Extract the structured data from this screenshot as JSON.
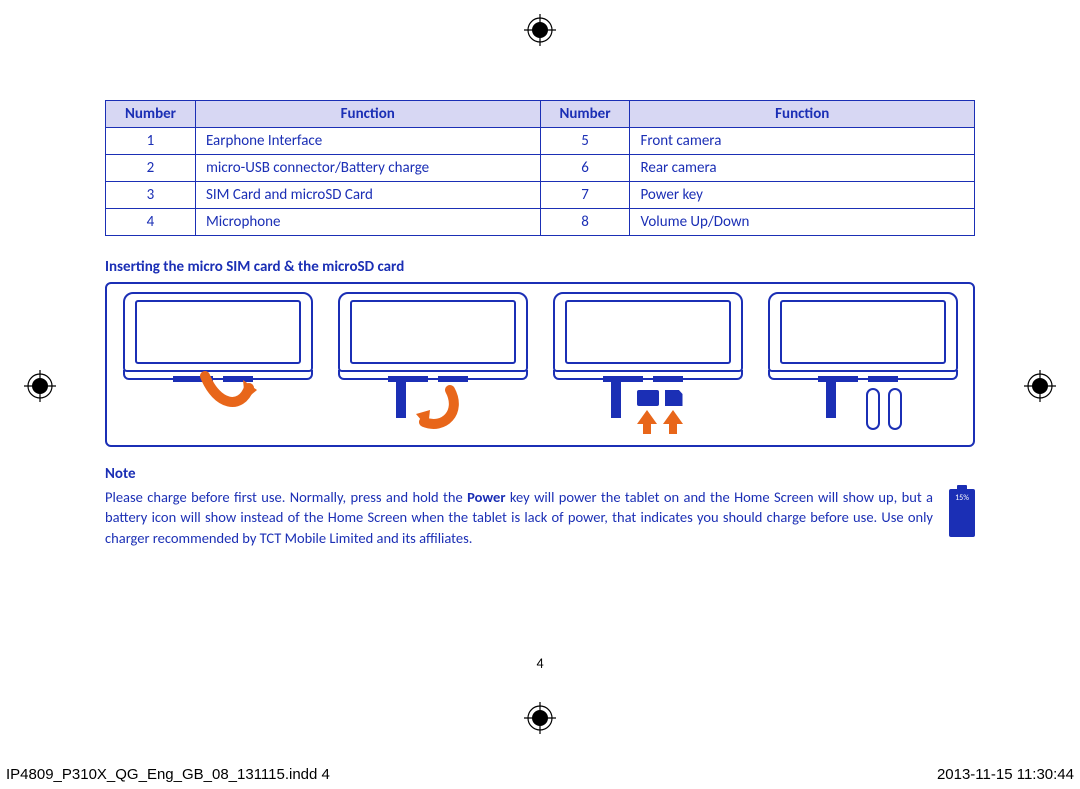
{
  "table": {
    "headers": {
      "number": "Number",
      "function": "Function"
    },
    "rows": [
      {
        "n1": "1",
        "f1": "Earphone Interface",
        "n2": "5",
        "f2": "Front camera"
      },
      {
        "n1": "2",
        "f1": "micro-USB connector/Battery charge",
        "n2": "6",
        "f2": "Rear camera"
      },
      {
        "n1": "3",
        "f1": "SIM Card and microSD Card",
        "n2": "7",
        "f2": "Power key"
      },
      {
        "n1": "4",
        "f1": "Microphone",
        "n2": "8",
        "f2": "Volume Up/Down"
      }
    ]
  },
  "sectionTitle": "Inserting the micro SIM card & the microSD card",
  "note": {
    "title": "Note",
    "body_pre": "Please charge before first use. Normally, press and hold the ",
    "body_bold": "Power",
    "body_post": " key will power the tablet on and the Home Screen will show up, but a battery icon will show instead of the Home Screen when the tablet is lack of power, that indicates you should charge before use. Use only charger recommended by TCT Mobile Limited and its affiliates."
  },
  "batteryLabel": "15%",
  "pageNumber": "4",
  "footer": {
    "file": "IP4809_P310X_QG_Eng_GB_08_131115.indd   4",
    "datetime": "2013-11-15   11:30:44"
  }
}
